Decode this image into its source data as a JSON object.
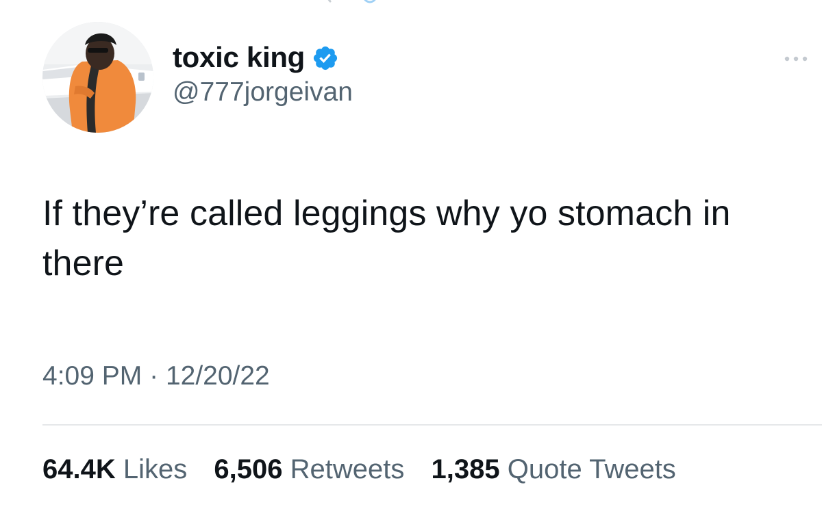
{
  "tweet": {
    "author": {
      "display_name": "toxic king",
      "handle": "@777jorgeivan",
      "verified": true,
      "verified_icon": "verified-badge-icon",
      "verified_color": "#1d9bf0"
    },
    "more_icon": "more-dots-icon",
    "text": "If they’re called leggings why yo stomach in there",
    "time": "4:09 PM",
    "separator": "·",
    "date": "12/20/22",
    "stats": {
      "likes_count": "64.4K",
      "likes_label": "Likes",
      "retweets_count": "6,506",
      "retweets_label": "Retweets",
      "quotes_count": "1,385",
      "quotes_label": "Quote Tweets"
    }
  },
  "colors": {
    "text": "#0f1419",
    "secondary": "#536471",
    "divider": "#e6e8ea",
    "accent": "#1d9bf0"
  }
}
